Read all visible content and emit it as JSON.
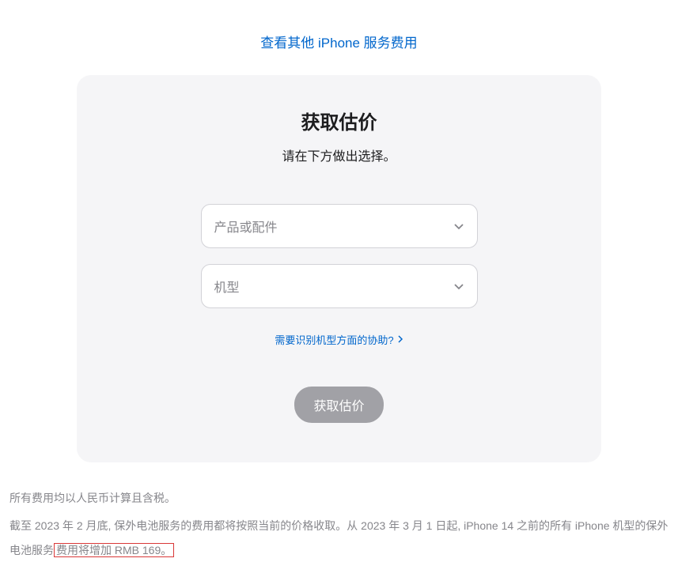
{
  "topLink": {
    "label": "查看其他 iPhone 服务费用"
  },
  "card": {
    "title": "获取估价",
    "subtitle": "请在下方做出选择。",
    "select1": {
      "placeholder": "产品或配件"
    },
    "select2": {
      "placeholder": "机型"
    },
    "helpLink": "需要识别机型方面的协助?",
    "submitLabel": "获取估价"
  },
  "footer": {
    "line1": "所有费用均以人民币计算且含税。",
    "line2_part1": "截至 2023 年 2 月底, 保外电池服务的费用都将按照当前的价格收取。从 2023 年 3 月 1 日起, iPhone 14 之前的所有 iPhone 机型的保外电池服务",
    "line2_highlight": "费用将增加 RMB 169。"
  }
}
